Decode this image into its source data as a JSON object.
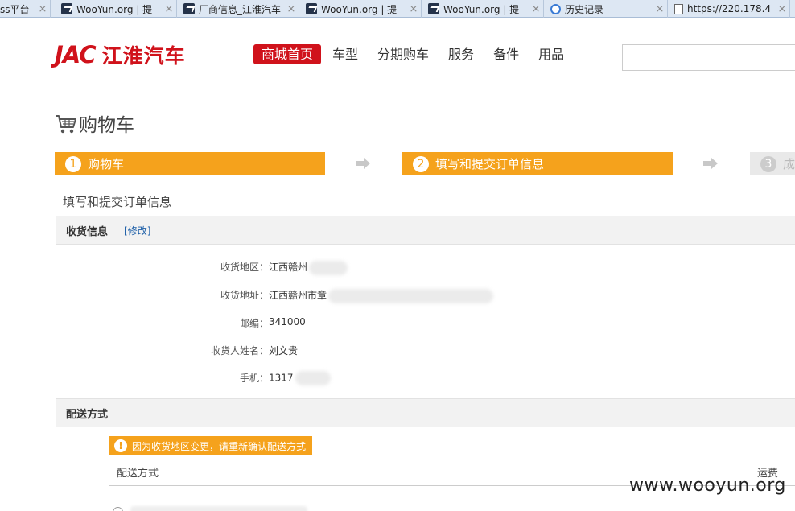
{
  "browser": {
    "tabs": [
      {
        "title": "ss平台",
        "icon": "generic-icon"
      },
      {
        "title": "WooYun.org | 提",
        "icon": "wooyun-icon"
      },
      {
        "title": "厂商信息_江淮汽车",
        "icon": "wooyun-icon"
      },
      {
        "title": "WooYun.org | 提",
        "icon": "wooyun-icon"
      },
      {
        "title": "WooYun.org | 提",
        "icon": "wooyun-icon"
      },
      {
        "title": "历史记录",
        "icon": "history-icon"
      },
      {
        "title": "https://220.178.4",
        "icon": "page-icon"
      }
    ],
    "close_glyph": "×"
  },
  "header": {
    "logo_latin": "JAC",
    "logo_cn": "江淮汽车",
    "nav": [
      {
        "label": "商城首页",
        "active": true
      },
      {
        "label": "车型"
      },
      {
        "label": "分期购车"
      },
      {
        "label": "服务"
      },
      {
        "label": "备件"
      },
      {
        "label": "用品"
      }
    ],
    "search_placeholder": ""
  },
  "page": {
    "title": "购物车",
    "steps": [
      {
        "num": "1",
        "label": "购物车",
        "state": "done"
      },
      {
        "num": "2",
        "label": "填写和提交订单信息",
        "state": "current"
      },
      {
        "num": "3",
        "label": "成",
        "state": "pending"
      }
    ],
    "subtitle": "填写和提交订单信息"
  },
  "shipping_info": {
    "title": "收货信息",
    "edit_label": "[修改]",
    "rows": [
      {
        "label": "收货地区：",
        "value": "江西赣州"
      },
      {
        "label": "收货地址：",
        "value": "江西赣州市章"
      },
      {
        "label": "邮编：",
        "value": "341000"
      },
      {
        "label": "收货人姓名：",
        "value": "刘文贵"
      },
      {
        "label": "手机：",
        "value": "1317"
      }
    ]
  },
  "delivery": {
    "title": "配送方式",
    "alert": "因为收货地区变更，请重新确认配送方式",
    "col_method": "配送方式",
    "col_fee": "运费"
  },
  "watermark": "www.wooyun.org",
  "colors": {
    "brand_red": "#d0121b",
    "step_orange": "#f5a21c",
    "link_blue": "#1d5fa8"
  }
}
